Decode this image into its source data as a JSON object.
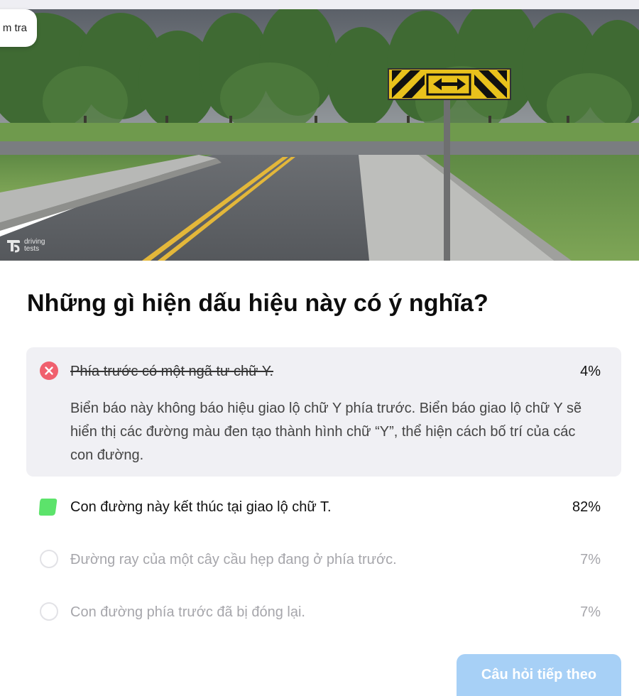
{
  "header": {
    "back_label": "m tra"
  },
  "image": {
    "watermark": "driving tests"
  },
  "question": "Những gì hiện dấu hiệu này có ý nghĩa?",
  "answers": [
    {
      "text": "Phía trước có một ngã tư chữ Y.",
      "percent": "4%",
      "state": "wrong",
      "explanation": "Biển báo này không báo hiệu giao lộ chữ Y phía trước. Biển báo giao lộ chữ Y sẽ hiển thị các đường màu đen tạo thành hình chữ “Y”, thể hiện cách bố trí của các con đường."
    },
    {
      "text": "Con đường này kết thúc tại giao lộ chữ T.",
      "percent": "82%",
      "state": "correct"
    },
    {
      "text": "Đường ray của một cây cầu hẹp đang ở phía trước.",
      "percent": "7%",
      "state": "unselected"
    },
    {
      "text": "Con đường phía trước đã bị đóng lại.",
      "percent": "7%",
      "state": "unselected"
    }
  ],
  "footer": {
    "next_label": "Câu hỏi tiếp theo"
  },
  "colors": {
    "wrong": "#f0606e",
    "correct": "#5ce36b",
    "button": "#a7d0f6",
    "wrong_bg": "#f0f0f4"
  }
}
